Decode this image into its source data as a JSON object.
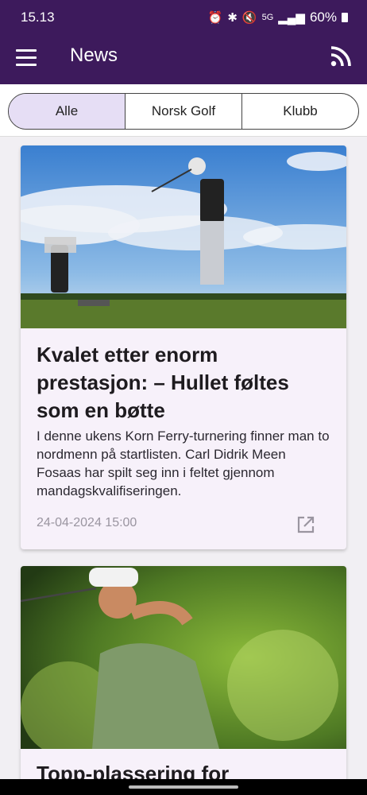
{
  "status": {
    "time": "15.13",
    "signal_label": "5G",
    "battery": "60%"
  },
  "appbar": {
    "title": "News"
  },
  "tabs": [
    "Alle",
    "Norsk Golf",
    "Klubb"
  ],
  "selected_tab": "Alle",
  "articles": [
    {
      "title": "Kvalet etter enorm prestasjon: – Hullet føltes som en bøtte",
      "summary": "I denne ukens Korn Ferry-turnering finner man to nordmenn på startlisten. Carl Didrik Meen Fosaas har spilt seg inn i feltet gjennom mandagskvalifiseringen.",
      "date": "24-04-2024 15:00"
    },
    {
      "title": "Topp-plassering for"
    }
  ],
  "colors": {
    "primary": "#3d1a5c",
    "selected_tab_bg": "#e6def5",
    "card_bg": "#f7f1fa"
  }
}
